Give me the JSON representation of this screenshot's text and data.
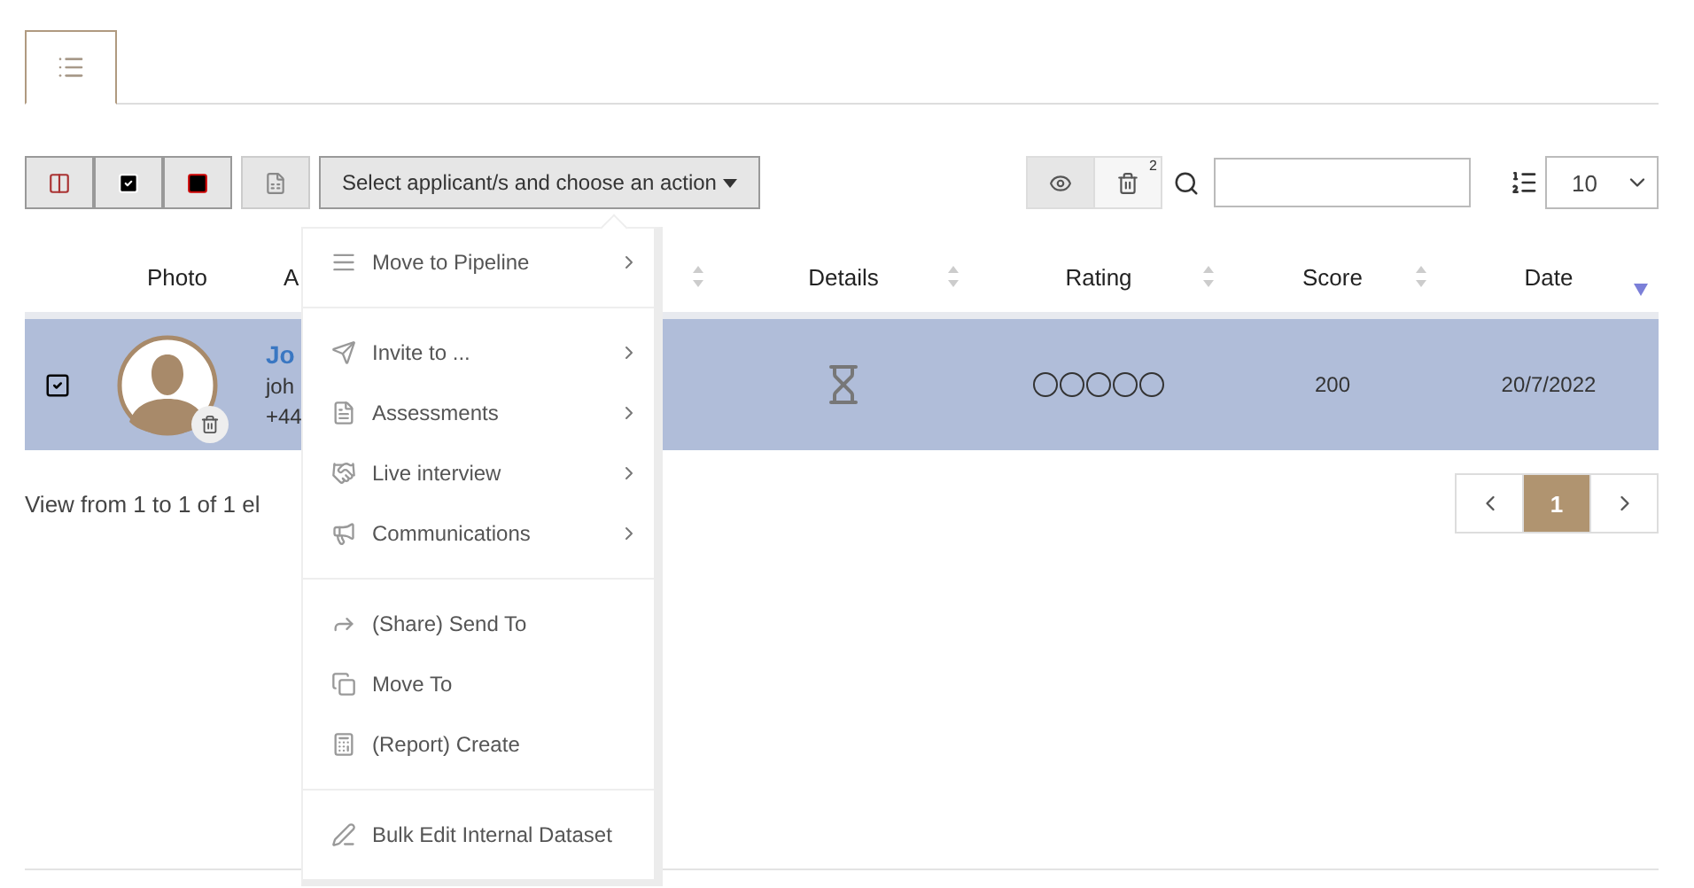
{
  "tabs": [
    {
      "kind": "list",
      "selected": true
    }
  ],
  "toolbar": {
    "action_button": {
      "label": "Select applicant/s and choose an action",
      "expanded": true
    },
    "trash_badge": "2",
    "page_size": "10"
  },
  "table": {
    "columns": [
      {},
      {
        "label": "Photo"
      },
      {
        "label": "A",
        "sortable": true
      },
      {
        "label": "Details",
        "sortable": true
      },
      {
        "label": "Rating",
        "sortable": true
      },
      {
        "label": "Score",
        "sortable": true
      },
      {
        "label": "Date",
        "sortable": true,
        "sorted_descending": true
      }
    ],
    "rows": [
      {
        "selected": true,
        "checked": true,
        "name": "Jo",
        "email": "joh",
        "phone": "+44",
        "stars": 0,
        "score": "200",
        "date": "20/7/2022"
      }
    ]
  },
  "footer": {
    "summary": "View from 1 to 1 of 1 el",
    "pages": [
      {
        "label": "1",
        "selected": true
      }
    ]
  },
  "action_menu": {
    "groups": [
      [
        {
          "label": "Move to Pipeline",
          "submenu": true
        }
      ],
      [
        {
          "label": "Invite to ...",
          "submenu": true
        },
        {
          "label": "Assessments",
          "submenu": true
        },
        {
          "label": "Live interview",
          "submenu": true
        },
        {
          "label": "Communications",
          "submenu": true
        }
      ],
      [
        {
          "label": "(Share) Send To",
          "submenu": false
        },
        {
          "label": "Move To",
          "submenu": false
        },
        {
          "label": "(Report) Create",
          "submenu": false
        }
      ],
      [
        {
          "label": "Bulk Edit Internal Dataset",
          "submenu": false
        }
      ]
    ]
  }
}
